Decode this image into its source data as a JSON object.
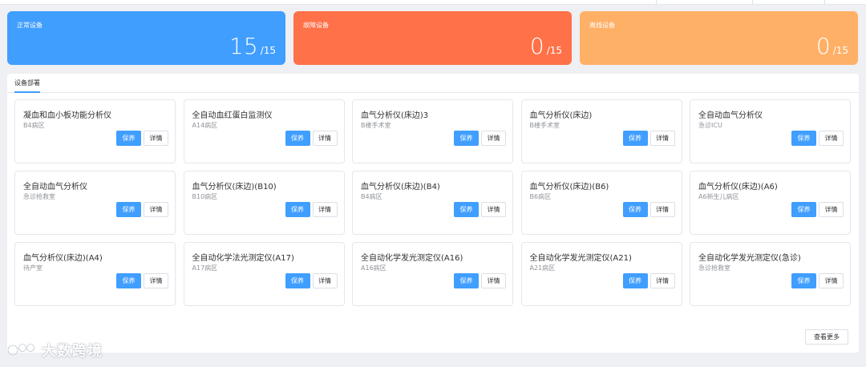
{
  "stats": [
    {
      "label": "正常设备",
      "value": "15",
      "total": "/15",
      "color": "#409eff"
    },
    {
      "label": "故障设备",
      "value": "0",
      "total": "/15",
      "color": "#ff7148"
    },
    {
      "label": "离线设备",
      "value": "0",
      "total": "/15",
      "color": "#ffb067"
    }
  ],
  "panel": {
    "tab": "设备部署",
    "maintain_label": "保养",
    "detail_label": "详情",
    "more_label": "查看更多"
  },
  "devices": [
    {
      "name": "凝血和血小板功能分析仪",
      "location": "B4病区"
    },
    {
      "name": "全自动血红蛋白监测仪",
      "location": "A14病区"
    },
    {
      "name": "血气分析仪(床边)3",
      "location": "B楼手术室"
    },
    {
      "name": "血气分析仪(床边)",
      "location": "B楼手术室"
    },
    {
      "name": "全自动血气分析仪",
      "location": "急诊ICU"
    },
    {
      "name": "全自动血气分析仪",
      "location": "急诊抢救室"
    },
    {
      "name": "血气分析仪(床边)(B10)",
      "location": "B10病区"
    },
    {
      "name": "血气分析仪(床边)(B4)",
      "location": "B4病区"
    },
    {
      "name": "血气分析仪(床边)(B6)",
      "location": "B6病区"
    },
    {
      "name": "血气分析仪(床边)(A6)",
      "location": "A6新生儿病区"
    },
    {
      "name": "血气分析仪(床边)(A4)",
      "location": "待产室"
    },
    {
      "name": "全自动化学法光测定仪(A17)",
      "location": "A17病区"
    },
    {
      "name": "全自动化学发光测定仪(A16)",
      "location": "A16病区"
    },
    {
      "name": "全自动化学发光测定仪(A21)",
      "location": "A21病区"
    },
    {
      "name": "全自动化学发光测定仪(急诊)",
      "location": "急诊抢救室"
    }
  ],
  "watermark": {
    "text": "大数跨境",
    "icon": "brand-logo-icon"
  }
}
